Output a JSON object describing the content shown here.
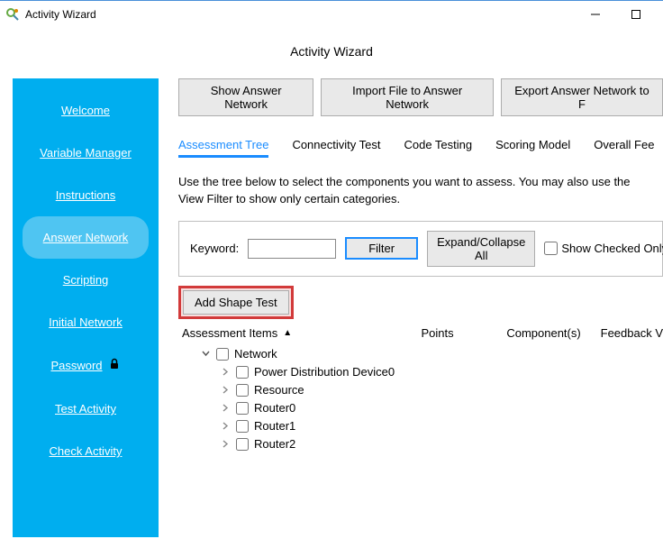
{
  "window": {
    "title": "Activity Wizard"
  },
  "page_title": "Activity Wizard",
  "sidebar": {
    "items": [
      {
        "label": "Welcome",
        "active": false
      },
      {
        "label": "Variable Manager",
        "active": false
      },
      {
        "label": "Instructions",
        "active": false
      },
      {
        "label": "Answer Network",
        "active": true
      },
      {
        "label": "Scripting",
        "active": false
      },
      {
        "label": "Initial Network",
        "active": false
      },
      {
        "label": "Password",
        "active": false,
        "icon": "lock"
      },
      {
        "label": "Test Activity",
        "active": false
      },
      {
        "label": "Check Activity",
        "active": false
      }
    ]
  },
  "toolbar": {
    "show_answer": "Show Answer Network",
    "import_file": "Import File to Answer Network",
    "export_file": "Export Answer Network to F"
  },
  "tabs": [
    {
      "label": "Assessment Tree",
      "active": true
    },
    {
      "label": "Connectivity Test",
      "active": false
    },
    {
      "label": "Code Testing",
      "active": false
    },
    {
      "label": "Scoring Model",
      "active": false
    },
    {
      "label": "Overall Fee",
      "active": false
    }
  ],
  "instructions_text": "Use the tree below to select the components you want to assess. You may also use the View Filter to show only certain categories.",
  "filter": {
    "keyword_label": "Keyword:",
    "keyword_value": "",
    "filter_btn": "Filter",
    "expand_btn": "Expand/Collapse All",
    "show_checked_label": "Show Checked Only"
  },
  "add_shape_btn": "Add Shape Test",
  "tree_header": {
    "col1": "Assessment Items",
    "col2": "Points",
    "col3": "Component(s)",
    "col4": "Feedback V"
  },
  "tree": {
    "root": {
      "label": "Network",
      "expanded": true
    },
    "children": [
      {
        "label": "Power Distribution Device0"
      },
      {
        "label": "Resource"
      },
      {
        "label": "Router0"
      },
      {
        "label": "Router1"
      },
      {
        "label": "Router2"
      }
    ]
  }
}
